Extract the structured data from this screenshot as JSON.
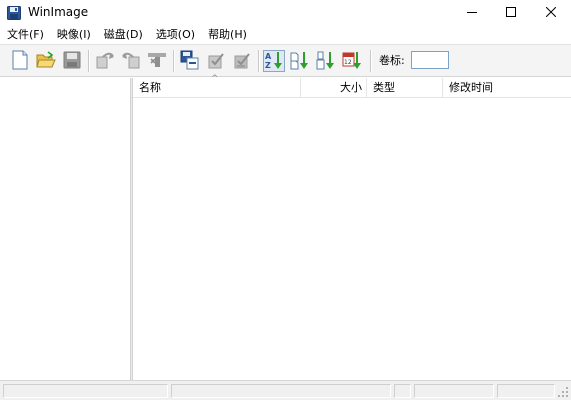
{
  "window": {
    "title": "WinImage",
    "icon": "floppy-disk-icon",
    "controls": [
      "minimize-icon",
      "maximize-icon",
      "close-icon"
    ]
  },
  "menu": {
    "items": [
      {
        "label": "文件(F)"
      },
      {
        "label": "映像(I)"
      },
      {
        "label": "磁盘(D)"
      },
      {
        "label": "选项(O)"
      },
      {
        "label": "帮助(H)"
      }
    ]
  },
  "toolbar": {
    "buttons": [
      {
        "icon": "new-file-icon",
        "enabled": true
      },
      {
        "icon": "open-folder-icon",
        "enabled": true
      },
      {
        "icon": "save-icon",
        "enabled": false
      },
      {
        "icon": "extract-icon",
        "enabled": false
      },
      {
        "icon": "inject-icon",
        "enabled": false
      },
      {
        "icon": "delete-icon",
        "enabled": false
      },
      {
        "icon": "read-disk-icon",
        "enabled": true
      },
      {
        "icon": "write-disk-icon",
        "enabled": false
      },
      {
        "icon": "format-write-icon",
        "enabled": false
      },
      {
        "icon": "sort-by-name-icon",
        "enabled": true,
        "pressed": true
      },
      {
        "icon": "sort-by-type-icon",
        "enabled": true
      },
      {
        "icon": "sort-by-size-icon",
        "enabled": true
      },
      {
        "icon": "sort-by-date-icon",
        "enabled": true
      }
    ],
    "volume_label": "卷标:",
    "volume_value": ""
  },
  "file_list": {
    "columns": [
      {
        "label": "名称",
        "sorted": "ascending"
      },
      {
        "label": "大小"
      },
      {
        "label": "类型"
      },
      {
        "label": "修改时间"
      }
    ],
    "rows": []
  },
  "status_bar": {
    "panes": [
      "",
      "",
      "",
      "",
      ""
    ]
  },
  "colors": {
    "accent_blue": "#2b5797",
    "toolbar_bg": "#f4f4f4",
    "folder_yellow": "#e8c24a",
    "arrow_green": "#2f9e2f"
  }
}
